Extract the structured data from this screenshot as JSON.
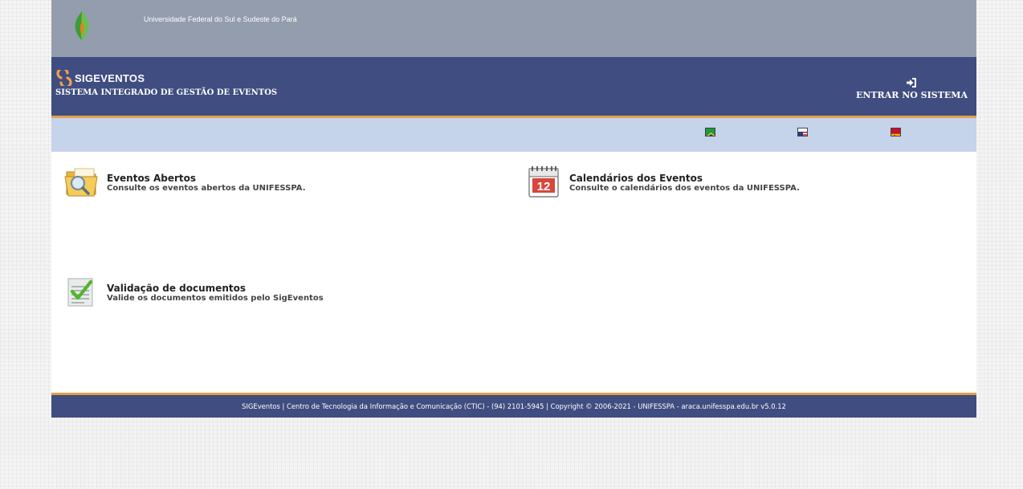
{
  "university": {
    "name": "Universidade Federal do Sul e Sudeste do Pará"
  },
  "header": {
    "system_name": "SIGEVENTOS",
    "system_subtitle": "SISTEMA INTEGRADO DE GESTÃO DE EVENTOS",
    "login_label": "ENTRAR NO SISTEMA"
  },
  "languages": [
    {
      "code": "pt-BR",
      "icon": "brazil-flag-icon"
    },
    {
      "code": "en",
      "icon": "usa-flag-icon"
    },
    {
      "code": "es",
      "icon": "spain-flag-icon"
    }
  ],
  "items": [
    {
      "title": "Eventos Abertos",
      "description": "Consulte os eventos abertos da UNIFESSPA.",
      "icon": "folder-search-icon"
    },
    {
      "title": "Calendários dos Eventos",
      "description": "Consulte o calendários dos eventos da UNIFESSPA.",
      "icon": "calendar-icon",
      "calendar_day": "12"
    },
    {
      "title": "Validação de documentos",
      "description": "Valide os documentos emitidos pelo SigEventos",
      "icon": "document-check-icon"
    }
  ],
  "footer": {
    "text": "SIGEventos | Centro de Tecnologia da Informação e Comunicação (CTIC) - (94) 2101-5945 | Copyright © 2006-2021 - UNIFESSPA - araca.unifesspa.edu.br v5.0.12"
  },
  "colors": {
    "topbar": "#939dad",
    "header": "#3f4d80",
    "accent": "#e2a14b",
    "langbar": "#c5d3eb"
  }
}
